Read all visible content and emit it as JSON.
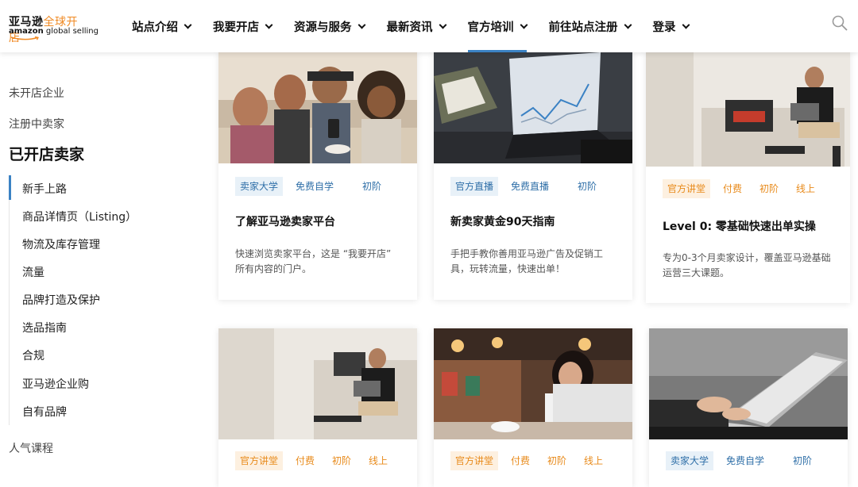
{
  "header": {
    "logo_cn_main": "亚马逊",
    "logo_cn_accent": "全球开店",
    "logo_en_bold": "amazon",
    "logo_en_rest": " global selling",
    "nav": [
      {
        "label": "站点介绍"
      },
      {
        "label": "我要开店"
      },
      {
        "label": "资源与服务"
      },
      {
        "label": "最新资讯"
      },
      {
        "label": "官方培训",
        "active": true
      },
      {
        "label": "前往站点注册"
      },
      {
        "label": "登录"
      }
    ],
    "accent_color": "#3b82c4"
  },
  "sidebar": {
    "top_items": [
      "未开店企业",
      "注册中卖家"
    ],
    "heading": "已开店卖家",
    "sub_items": [
      "新手上路",
      "商品详情页（Listing）",
      "物流及库存管理",
      "流量",
      "品牌打造及保护",
      "选品指南",
      "合规",
      "亚马逊企业购",
      "自有品牌"
    ],
    "bottom_item": "人气课程"
  },
  "cards": [
    {
      "tags": [
        "卖家大学",
        "免费自学",
        "初阶"
      ],
      "title": "了解亚马逊卖家平台",
      "desc": "快速浏览卖家平台，这是 “我要开店” 所有内容的门户。"
    },
    {
      "tags": [
        "官方直播",
        "免费直播",
        "初阶"
      ],
      "title": "新卖家黄金90天指南",
      "desc": "手把手教你善用亚马逊广告及促销工具，玩转流量，快速出单！"
    },
    {
      "tags": [
        "官方讲堂",
        "付费",
        "初阶",
        "线上"
      ],
      "title": "Level 0: 零基础快速出单实操",
      "desc": "专为0-3个月卖家设计，覆盖亚马逊基础运营三大课题。"
    },
    {
      "tags": [
        "官方讲堂",
        "付费",
        "初阶",
        "线上"
      ]
    },
    {
      "tags": [
        "官方讲堂",
        "付费",
        "初阶",
        "线上"
      ]
    },
    {
      "tags": [
        "卖家大学",
        "免费自学",
        "初阶"
      ]
    }
  ]
}
